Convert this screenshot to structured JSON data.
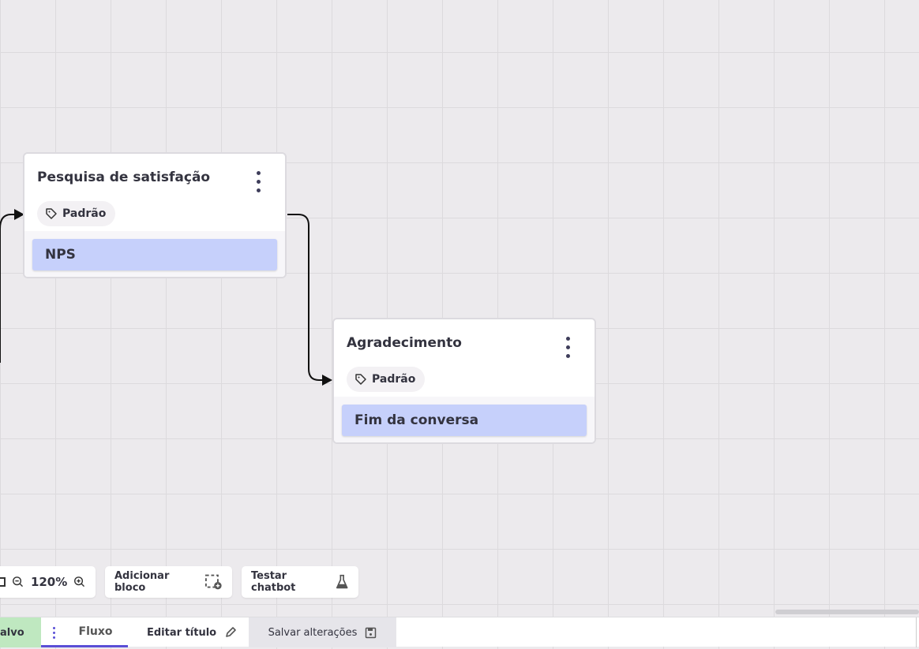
{
  "nodes": [
    {
      "title": "Pesquisa de satisfação",
      "tag": "Padrão",
      "item": "NPS"
    },
    {
      "title": "Agradecimento",
      "tag": "Padrão",
      "item": "Fim da conversa"
    }
  ],
  "toolbar": {
    "zoom": "120%",
    "add_block": "Adicionar bloco",
    "test_chatbot": "Testar chatbot"
  },
  "bottom": {
    "saved": "alvo",
    "tab_flow": "Fluxo",
    "edit_title": "Editar título",
    "save_changes": "Salvar alterações"
  },
  "colors": {
    "accent": "#5a4fd6",
    "saved_bg": "#bfe8c0",
    "item_bg": "#c6d0fb"
  }
}
